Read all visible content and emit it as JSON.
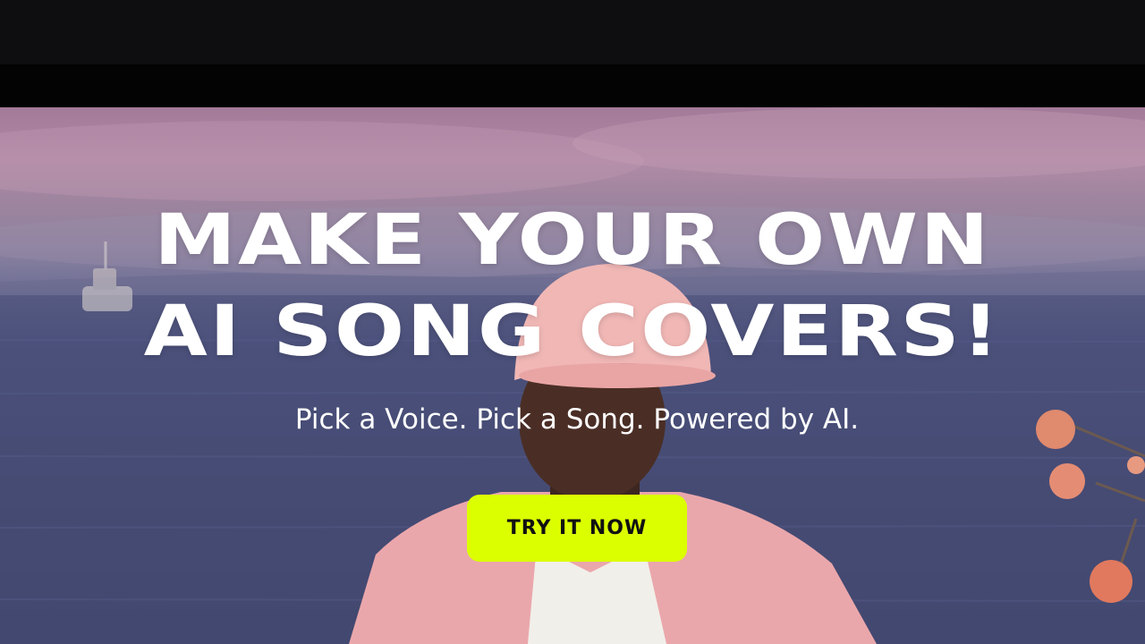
{
  "hero": {
    "headline_line1": "MAKE YOUR OWN",
    "headline_line2": "AI SONG COVERS!",
    "subtitle": "Pick a Voice. Pick a Song. Powered by AI.",
    "cta_label": "TRY IT NOW"
  },
  "colors": {
    "cta_background": "#dcff00",
    "top_bar": "#0e0e10",
    "nav_strip": "#030303",
    "headline_text": "#ffffff"
  }
}
